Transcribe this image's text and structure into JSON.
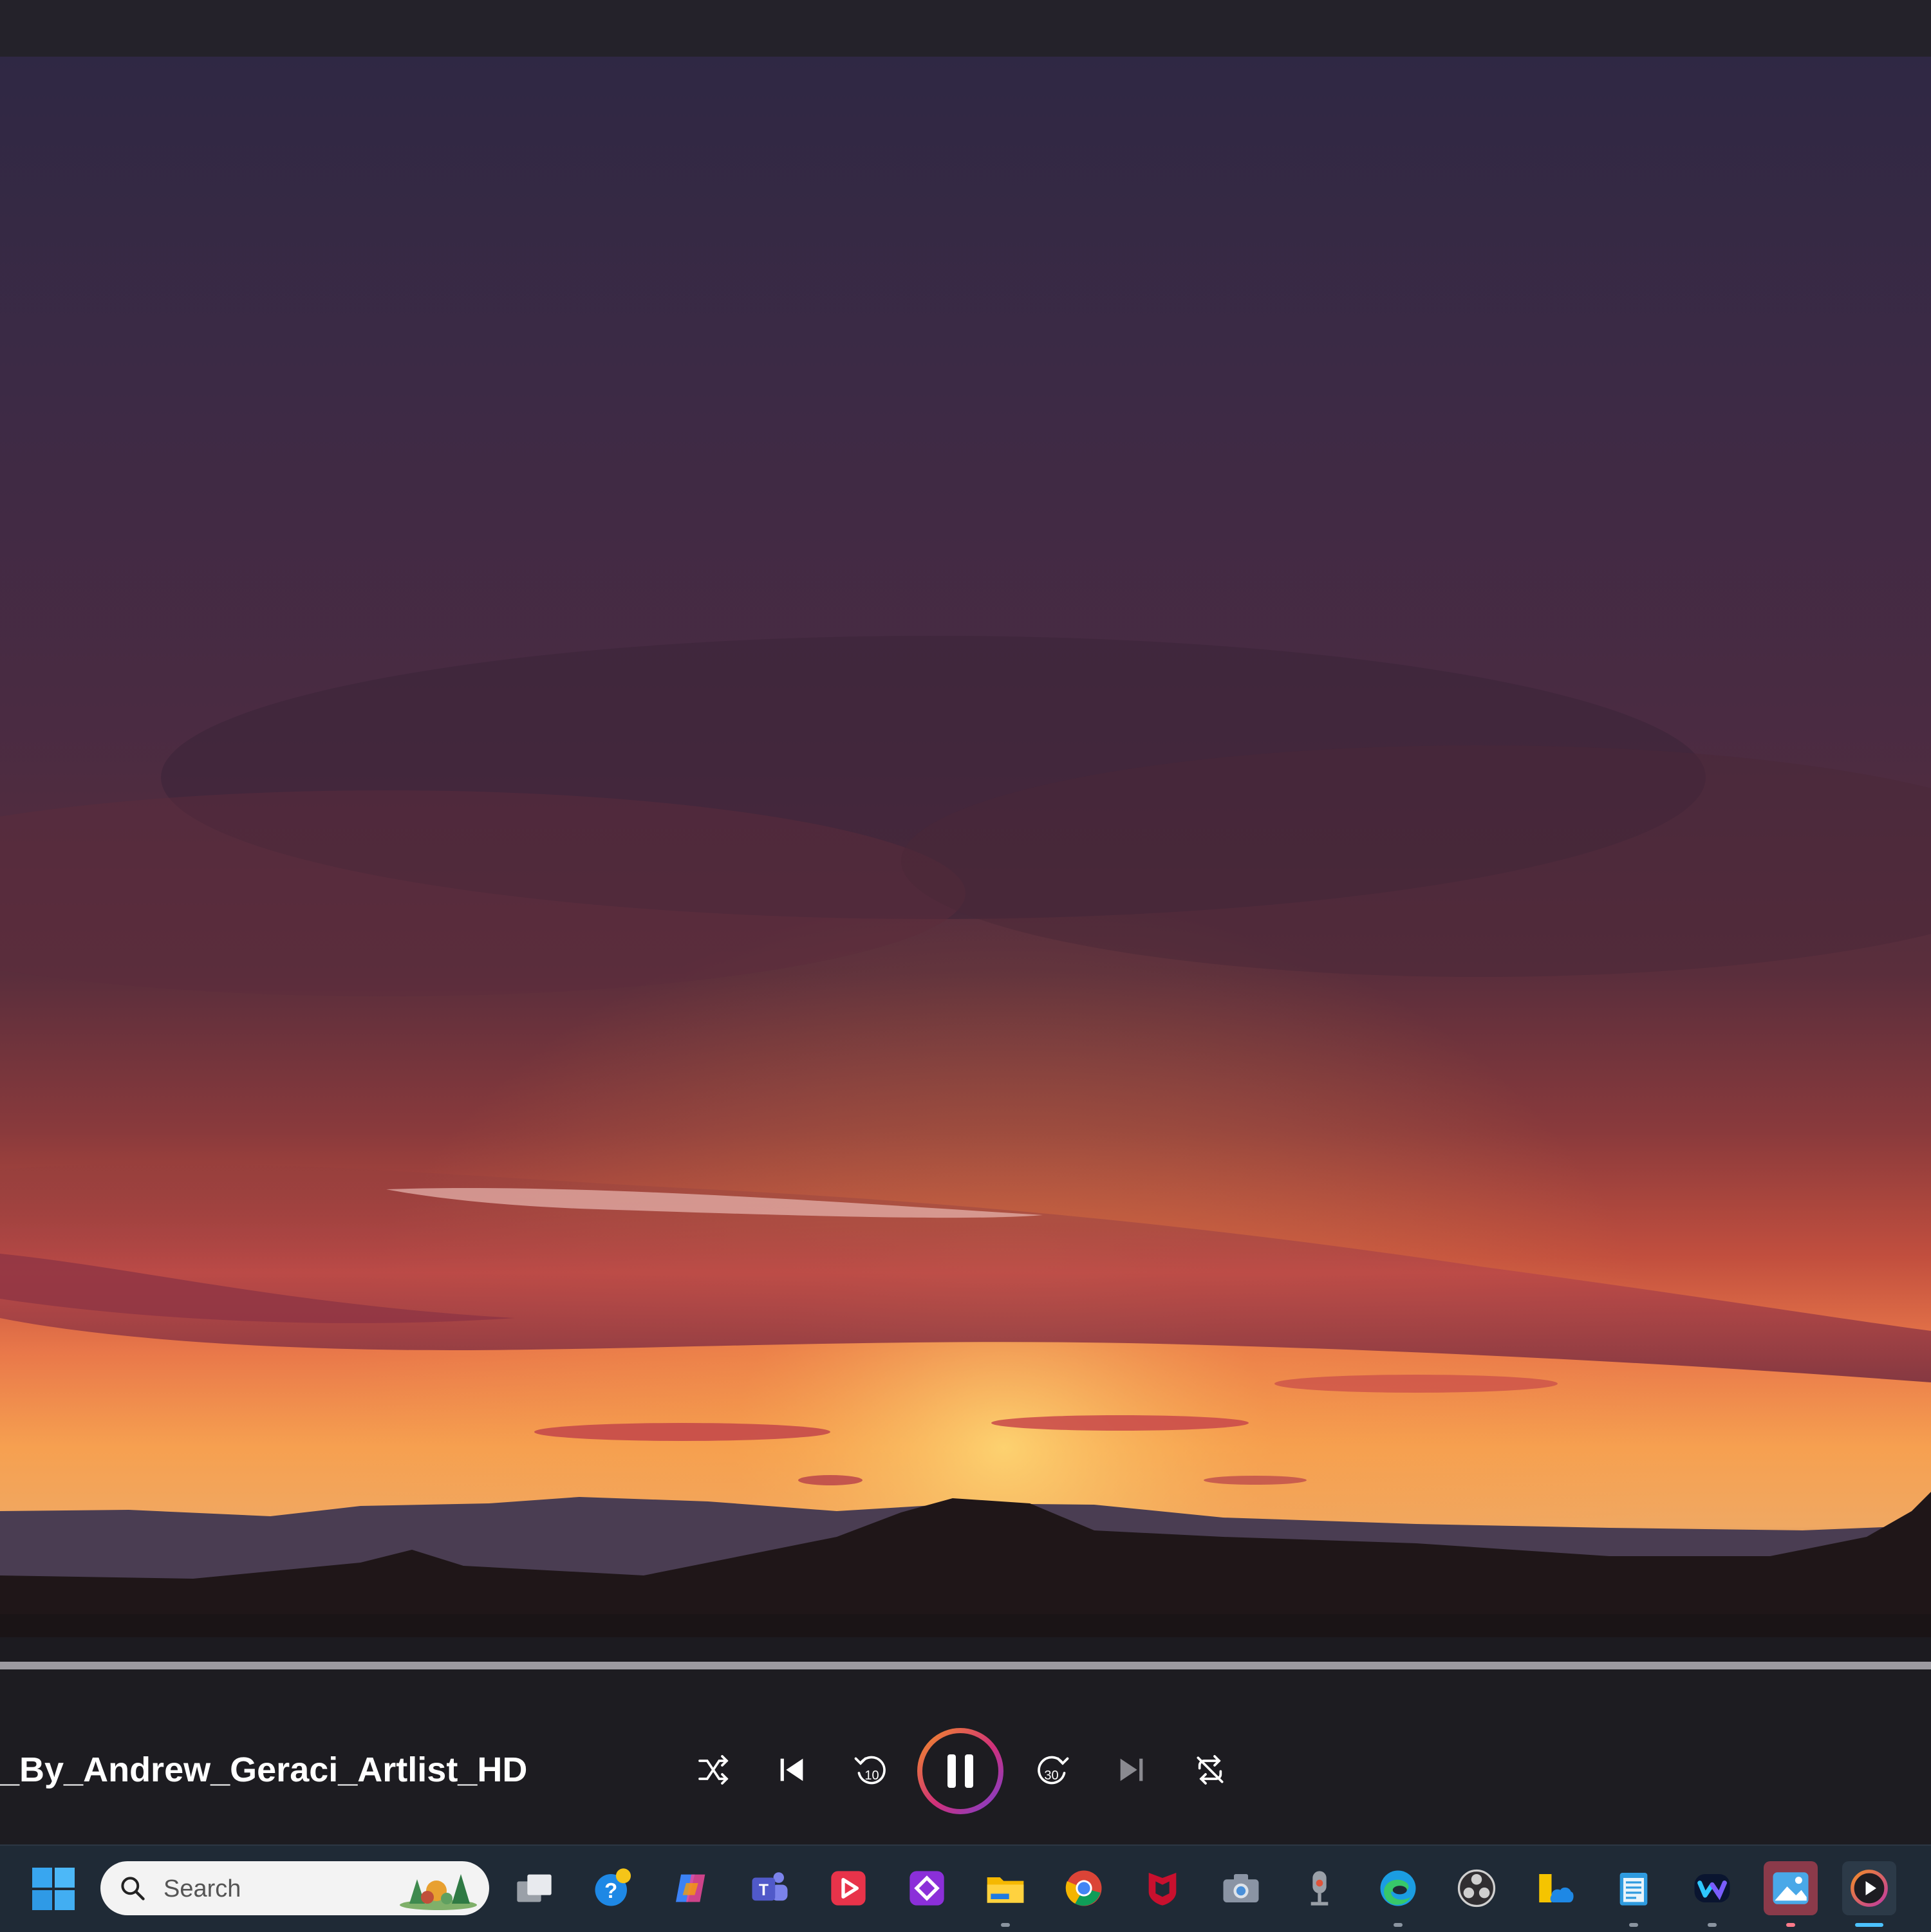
{
  "player": {
    "media_title": "_By_Andrew_Geraci_Artlist_HD",
    "progress": 0.0,
    "state": "playing",
    "accent_gradient": [
      "#f28c28",
      "#d0307a",
      "#7a3fd0"
    ]
  },
  "controls": [
    {
      "name": "shuffle-button",
      "icon": "shuffle-icon"
    },
    {
      "name": "previous-button",
      "icon": "previous-track-icon"
    },
    {
      "name": "skip-back-button",
      "icon": "skip-back-10-icon",
      "label": "10"
    },
    {
      "name": "pause-button",
      "icon": "pause-icon"
    },
    {
      "name": "skip-forward-button",
      "icon": "skip-forward-30-icon",
      "label": "30"
    },
    {
      "name": "next-button",
      "icon": "next-track-icon"
    },
    {
      "name": "repeat-button",
      "icon": "repeat-off-icon"
    }
  ],
  "taskbar": {
    "search_placeholder": "Search",
    "apps": [
      "task-view-icon",
      "help-icon",
      "copilot-icon",
      "teams-icon",
      "media-app-icon",
      "power-automate-icon",
      "file-explorer-icon",
      "chrome-icon",
      "mcafee-icon",
      "camera-icon",
      "microphone-icon",
      "edge-icon",
      "obs-icon",
      "onedrive-folder-icon",
      "notepad-icon",
      "webex-icon",
      "photos-icon",
      "media-player-icon"
    ]
  },
  "colors": {
    "top_bar": "#24222a",
    "controls_bar": "#1d1c21",
    "taskbar": "#1f2a36",
    "sky_top": "#2f2844",
    "sky_bottom": "#f6a050"
  }
}
